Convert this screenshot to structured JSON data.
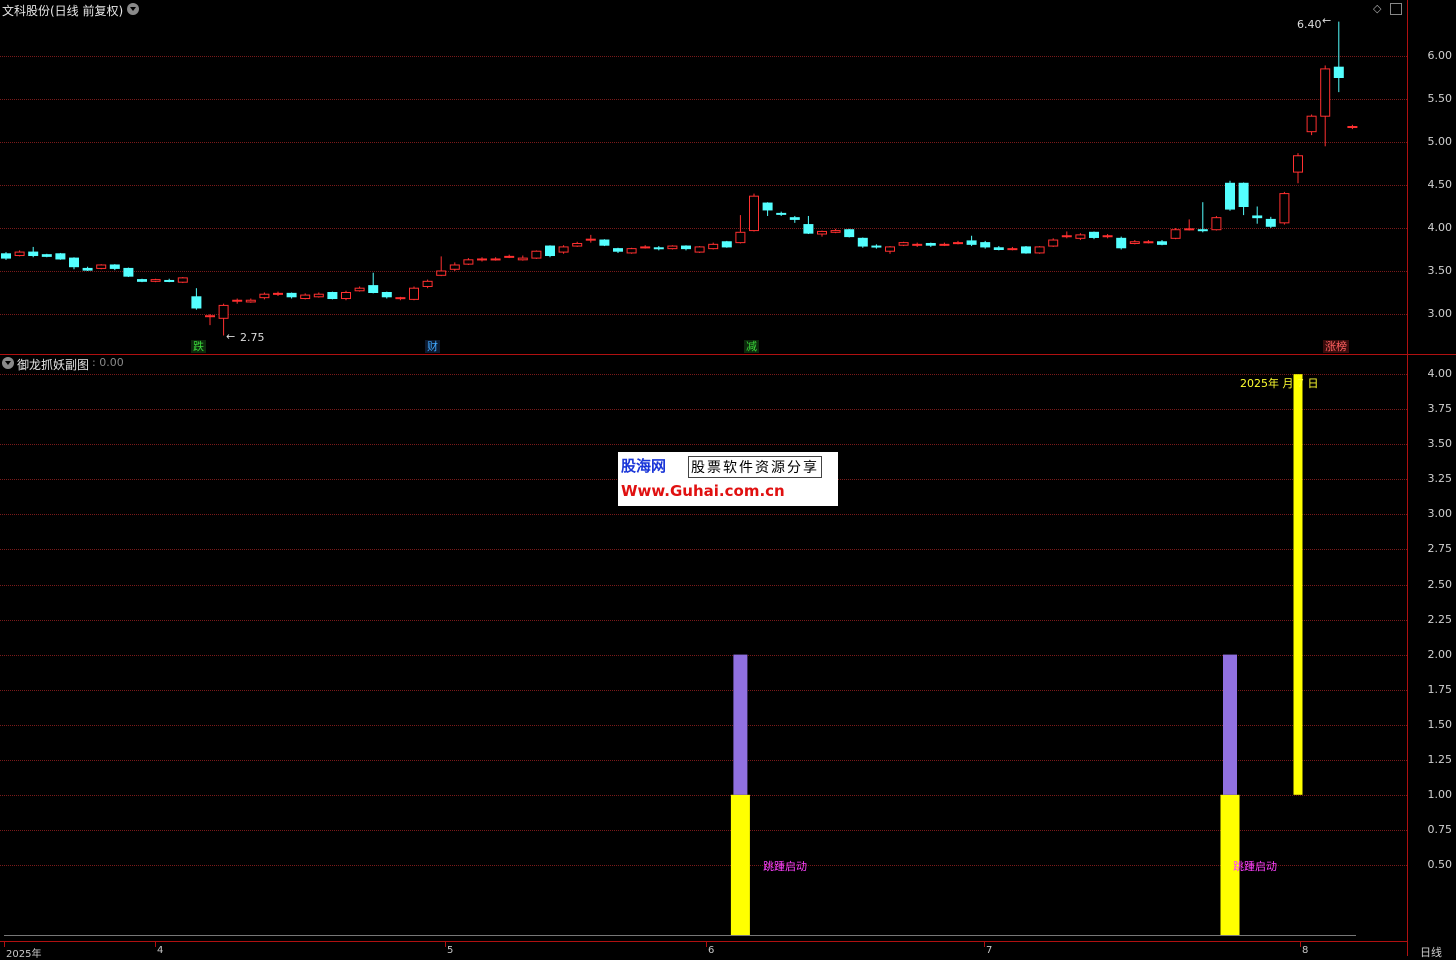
{
  "main": {
    "title": "文科股份(日线 前复权)",
    "y_ticks": [
      "6.00",
      "5.50",
      "5.00",
      "4.50",
      "4.00",
      "3.50",
      "3.00"
    ],
    "high_label": "6.40",
    "low_label": "2.75",
    "tags": [
      {
        "text": "跌",
        "color": "#3ad83a"
      },
      {
        "text": "财",
        "color": "#40a8ff"
      },
      {
        "text": "减",
        "color": "#3ad83a"
      },
      {
        "text": "涨榜",
        "color": "#ff6060"
      }
    ]
  },
  "sub": {
    "title": "御龙抓妖副图",
    "value": ": 0.00",
    "y_ticks": [
      "4.00",
      "3.75",
      "3.50",
      "3.25",
      "3.00",
      "2.75",
      "2.50",
      "2.25",
      "2.00",
      "1.75",
      "1.50",
      "1.25",
      "1.00",
      "0.75",
      "0.50"
    ],
    "signal_label_1": "跳踵启动",
    "signal_label_2": "跳踵启动",
    "date_label": "2025年 月 7 日"
  },
  "ad": {
    "brand": "股海网",
    "slogan": "股票软件资源分享",
    "url": "Www.Guhai.com.cn"
  },
  "x_axis": {
    "labels": [
      "2025年",
      "4",
      "5",
      "6",
      "7",
      "8"
    ],
    "period": "日线"
  },
  "colors": {
    "up": "#ff3030",
    "down": "#54ffff",
    "yellow": "#ffff00",
    "purple": "#9070e0",
    "grid": "#7a1a1a",
    "divider": "#b01010"
  },
  "chart_data": {
    "type": "candlestick",
    "ylim": [
      2.6,
      6.5
    ],
    "low_marker": 2.75,
    "high_marker": 6.4,
    "candles": [
      [
        3.7,
        3.65,
        3.72,
        3.63
      ],
      [
        3.68,
        3.72,
        3.74,
        3.67
      ],
      [
        3.72,
        3.68,
        3.78,
        3.66
      ],
      [
        3.69,
        3.67,
        3.7,
        3.66
      ],
      [
        3.7,
        3.64,
        3.71,
        3.63
      ],
      [
        3.65,
        3.55,
        3.66,
        3.52
      ],
      [
        3.53,
        3.51,
        3.55,
        3.5
      ],
      [
        3.53,
        3.57,
        3.58,
        3.52
      ],
      [
        3.57,
        3.53,
        3.58,
        3.51
      ],
      [
        3.53,
        3.44,
        3.54,
        3.43
      ],
      [
        3.4,
        3.38,
        3.41,
        3.37
      ],
      [
        3.38,
        3.4,
        3.41,
        3.37
      ],
      [
        3.39,
        3.38,
        3.41,
        3.37
      ],
      [
        3.37,
        3.42,
        3.43,
        3.36
      ],
      [
        3.2,
        3.07,
        3.3,
        3.05
      ],
      [
        2.97,
        2.98,
        3.0,
        2.87
      ],
      [
        2.95,
        3.1,
        3.12,
        2.75
      ],
      [
        3.15,
        3.16,
        3.18,
        3.12
      ],
      [
        3.14,
        3.16,
        3.18,
        3.13
      ],
      [
        3.19,
        3.23,
        3.25,
        3.17
      ],
      [
        3.23,
        3.24,
        3.26,
        3.21
      ],
      [
        3.24,
        3.2,
        3.25,
        3.18
      ],
      [
        3.18,
        3.22,
        3.24,
        3.17
      ],
      [
        3.2,
        3.23,
        3.25,
        3.19
      ],
      [
        3.25,
        3.18,
        3.26,
        3.17
      ],
      [
        3.18,
        3.25,
        3.27,
        3.16
      ],
      [
        3.27,
        3.3,
        3.32,
        3.26
      ],
      [
        3.33,
        3.25,
        3.48,
        3.24
      ],
      [
        3.25,
        3.2,
        3.26,
        3.18
      ],
      [
        3.18,
        3.19,
        3.2,
        3.16
      ],
      [
        3.17,
        3.3,
        3.32,
        3.16
      ],
      [
        3.32,
        3.38,
        3.4,
        3.3
      ],
      [
        3.45,
        3.5,
        3.67,
        3.44
      ],
      [
        3.52,
        3.57,
        3.6,
        3.5
      ],
      [
        3.58,
        3.63,
        3.65,
        3.57
      ],
      [
        3.63,
        3.64,
        3.66,
        3.61
      ],
      [
        3.64,
        3.64,
        3.66,
        3.62
      ],
      [
        3.66,
        3.67,
        3.69,
        3.65
      ],
      [
        3.63,
        3.65,
        3.68,
        3.62
      ],
      [
        3.65,
        3.73,
        3.74,
        3.64
      ],
      [
        3.79,
        3.68,
        3.8,
        3.66
      ],
      [
        3.72,
        3.78,
        3.8,
        3.7
      ],
      [
        3.79,
        3.82,
        3.84,
        3.78
      ],
      [
        3.86,
        3.87,
        3.92,
        3.83
      ],
      [
        3.86,
        3.8,
        3.87,
        3.79
      ],
      [
        3.76,
        3.73,
        3.77,
        3.71
      ],
      [
        3.71,
        3.76,
        3.77,
        3.7
      ],
      [
        3.78,
        3.78,
        3.8,
        3.76
      ],
      [
        3.77,
        3.76,
        3.79,
        3.74
      ],
      [
        3.76,
        3.79,
        3.8,
        3.75
      ],
      [
        3.79,
        3.76,
        3.8,
        3.74
      ],
      [
        3.72,
        3.78,
        3.79,
        3.71
      ],
      [
        3.76,
        3.81,
        3.83,
        3.75
      ],
      [
        3.84,
        3.78,
        3.85,
        3.77
      ],
      [
        3.83,
        3.95,
        4.15,
        3.82
      ],
      [
        3.97,
        4.37,
        4.4,
        3.96
      ],
      [
        4.29,
        4.21,
        4.3,
        4.14
      ],
      [
        4.17,
        4.16,
        4.19,
        4.14
      ],
      [
        4.12,
        4.1,
        4.14,
        4.06
      ],
      [
        4.04,
        3.94,
        4.14,
        3.93
      ],
      [
        3.93,
        3.96,
        3.97,
        3.9
      ],
      [
        3.95,
        3.97,
        3.99,
        3.94
      ],
      [
        3.98,
        3.9,
        3.99,
        3.89
      ],
      [
        3.88,
        3.79,
        3.89,
        3.77
      ],
      [
        3.79,
        3.78,
        3.81,
        3.76
      ],
      [
        3.73,
        3.78,
        3.79,
        3.7
      ],
      [
        3.8,
        3.83,
        3.84,
        3.79
      ],
      [
        3.8,
        3.81,
        3.83,
        3.78
      ],
      [
        3.82,
        3.8,
        3.83,
        3.78
      ],
      [
        3.8,
        3.81,
        3.83,
        3.79
      ],
      [
        3.82,
        3.83,
        3.85,
        3.81
      ],
      [
        3.85,
        3.81,
        3.91,
        3.79
      ],
      [
        3.83,
        3.78,
        3.85,
        3.76
      ],
      [
        3.77,
        3.75,
        3.79,
        3.74
      ],
      [
        3.76,
        3.76,
        3.78,
        3.74
      ],
      [
        3.78,
        3.71,
        3.79,
        3.7
      ],
      [
        3.71,
        3.78,
        3.79,
        3.7
      ],
      [
        3.79,
        3.86,
        3.88,
        3.78
      ],
      [
        3.9,
        3.91,
        3.96,
        3.88
      ],
      [
        3.88,
        3.92,
        3.94,
        3.86
      ],
      [
        3.95,
        3.89,
        3.96,
        3.87
      ],
      [
        3.9,
        3.91,
        3.93,
        3.88
      ],
      [
        3.88,
        3.77,
        3.9,
        3.75
      ],
      [
        3.82,
        3.84,
        3.86,
        3.81
      ],
      [
        3.84,
        3.84,
        3.86,
        3.82
      ],
      [
        3.84,
        3.81,
        3.86,
        3.8
      ],
      [
        3.88,
        3.98,
        4.0,
        3.87
      ],
      [
        3.98,
        3.99,
        4.1,
        3.97
      ],
      [
        3.98,
        3.97,
        4.3,
        3.95
      ],
      [
        3.98,
        4.12,
        4.14,
        3.97
      ],
      [
        4.52,
        4.22,
        4.55,
        4.2
      ],
      [
        4.52,
        4.25,
        4.53,
        4.15
      ],
      [
        4.14,
        4.12,
        4.25,
        4.05
      ],
      [
        4.1,
        4.02,
        4.13,
        4.0
      ],
      [
        4.06,
        4.4,
        4.42,
        4.04
      ],
      [
        4.65,
        4.84,
        4.87,
        4.52
      ],
      [
        5.12,
        5.3,
        5.32,
        5.08
      ],
      [
        5.3,
        5.85,
        5.89,
        4.95
      ],
      [
        5.87,
        5.75,
        6.4,
        5.58
      ],
      [
        5.18,
        5.18,
        5.2,
        5.15
      ]
    ],
    "sub_bars": [
      {
        "index": 54,
        "base": 0,
        "top": 1,
        "color": "yellow"
      },
      {
        "index": 54,
        "base": 1,
        "top": 2,
        "color": "purple"
      },
      {
        "index": 90,
        "base": 0,
        "top": 1,
        "color": "yellow"
      },
      {
        "index": 90,
        "base": 1,
        "top": 2,
        "color": "purple"
      },
      {
        "index": 95,
        "base": 1,
        "top": 4,
        "color": "yellow"
      }
    ],
    "sub_ylim": [
      0,
      4.2
    ]
  }
}
